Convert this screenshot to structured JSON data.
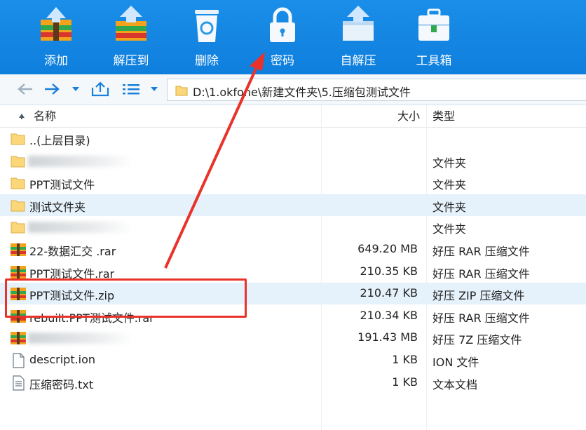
{
  "toolbar": {
    "items": [
      {
        "label": "添加",
        "icon": "add-archive-icon"
      },
      {
        "label": "解压到",
        "icon": "extract-to-icon"
      },
      {
        "label": "删除",
        "icon": "delete-icon"
      },
      {
        "label": "密码",
        "icon": "lock-icon"
      },
      {
        "label": "自解压",
        "icon": "self-extract-icon"
      },
      {
        "label": "工具箱",
        "icon": "toolbox-icon"
      }
    ]
  },
  "nav": {
    "path": "D:\\1.okfone\\新建文件夹\\5.压缩包测试文件"
  },
  "headers": {
    "name": "名称",
    "size": "大小",
    "type": "类型"
  },
  "files": [
    {
      "name": "..(上层目录)",
      "size": "",
      "type": "",
      "icon": "folder-icon",
      "blurred": false
    },
    {
      "name": "",
      "size": "",
      "type": "文件夹",
      "icon": "folder-icon",
      "blurred": true
    },
    {
      "name": "PPT测试文件",
      "size": "",
      "type": "文件夹",
      "icon": "folder-icon",
      "blurred": false
    },
    {
      "name": "测试文件夹",
      "size": "",
      "type": "文件夹",
      "icon": "folder-icon",
      "blurred": false
    },
    {
      "name": "",
      "size": "",
      "type": "文件夹",
      "icon": "folder-icon",
      "blurred": true
    },
    {
      "name": "22-数据汇交 .rar",
      "size": "649.20 MB",
      "type": "好压 RAR 压缩文件",
      "icon": "archive-icon",
      "blurred": false
    },
    {
      "name": "PPT测试文件.rar",
      "size": "210.35 KB",
      "type": "好压 RAR 压缩文件",
      "icon": "archive-icon",
      "blurred": false
    },
    {
      "name": "PPT测试文件.zip",
      "size": "210.47 KB",
      "type": "好压 ZIP 压缩文件",
      "icon": "archive-icon",
      "blurred": false
    },
    {
      "name": "rebuilt.PPT测试文件.rar",
      "size": "210.34 KB",
      "type": "好压 RAR 压缩文件",
      "icon": "archive-icon",
      "blurred": false
    },
    {
      "name": "",
      "size": "191.43 MB",
      "type": "好压 7Z 压缩文件",
      "icon": "archive-icon",
      "blurred": true
    },
    {
      "name": "descript.ion",
      "size": "1 KB",
      "type": "ION 文件",
      "icon": "file-icon",
      "blurred": false
    },
    {
      "name": "压缩密码.txt",
      "size": "1 KB",
      "type": "文本文档",
      "icon": "text-file-icon",
      "blurred": false
    }
  ],
  "colors": {
    "toolbar": "#1a8ee8",
    "selection": "#e5f1fb",
    "annotation": "#e8322a"
  }
}
